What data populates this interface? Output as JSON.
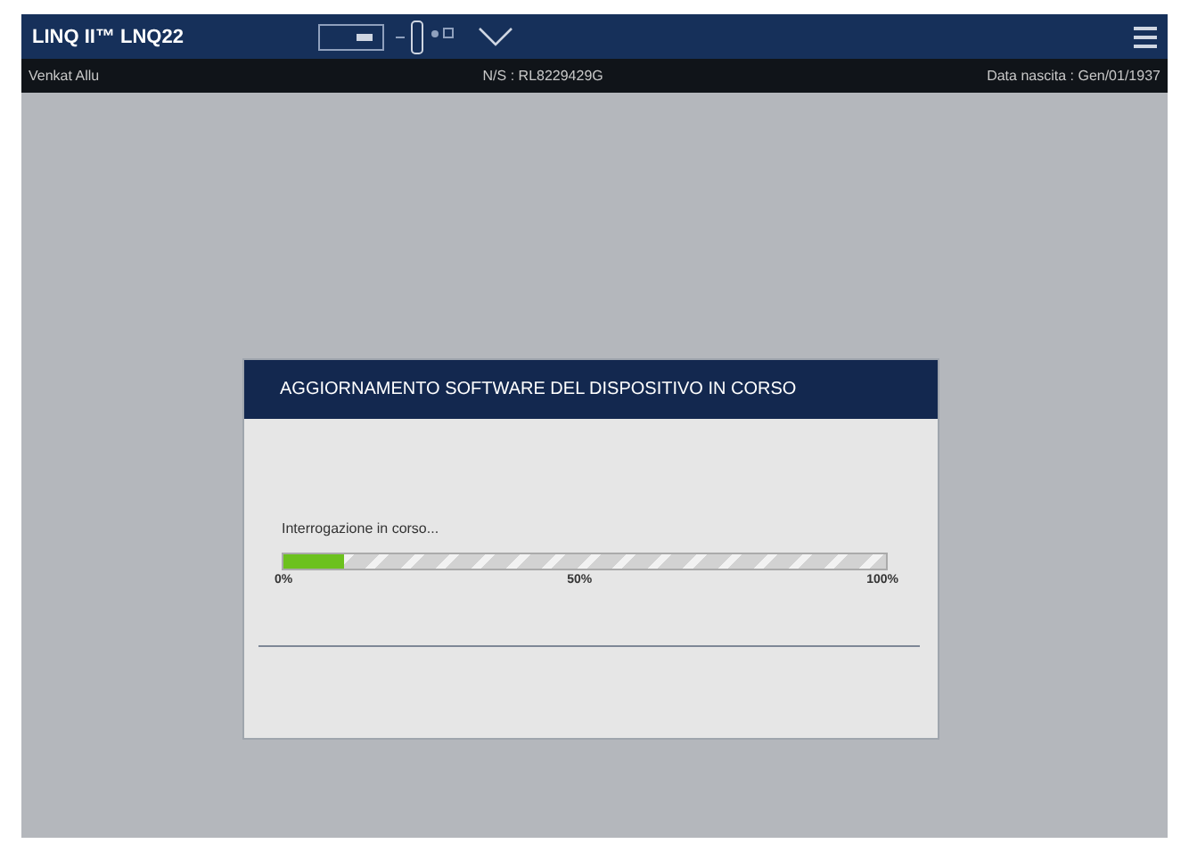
{
  "app_bar": {
    "title": "LINQ II™ LNQ22"
  },
  "patient_bar": {
    "name": "Venkat Allu",
    "serial": "N/S : RL8229429G",
    "birth_date": "Data nascita : Gen/01/1937"
  },
  "dialog": {
    "title": "AGGIORNAMENTO SOFTWARE DEL DISPOSITIVO IN CORSO",
    "status": "Interrogazione in corso...",
    "progress": {
      "level": 0.1,
      "ticks": [
        "0%",
        "50%",
        "100%"
      ]
    }
  }
}
